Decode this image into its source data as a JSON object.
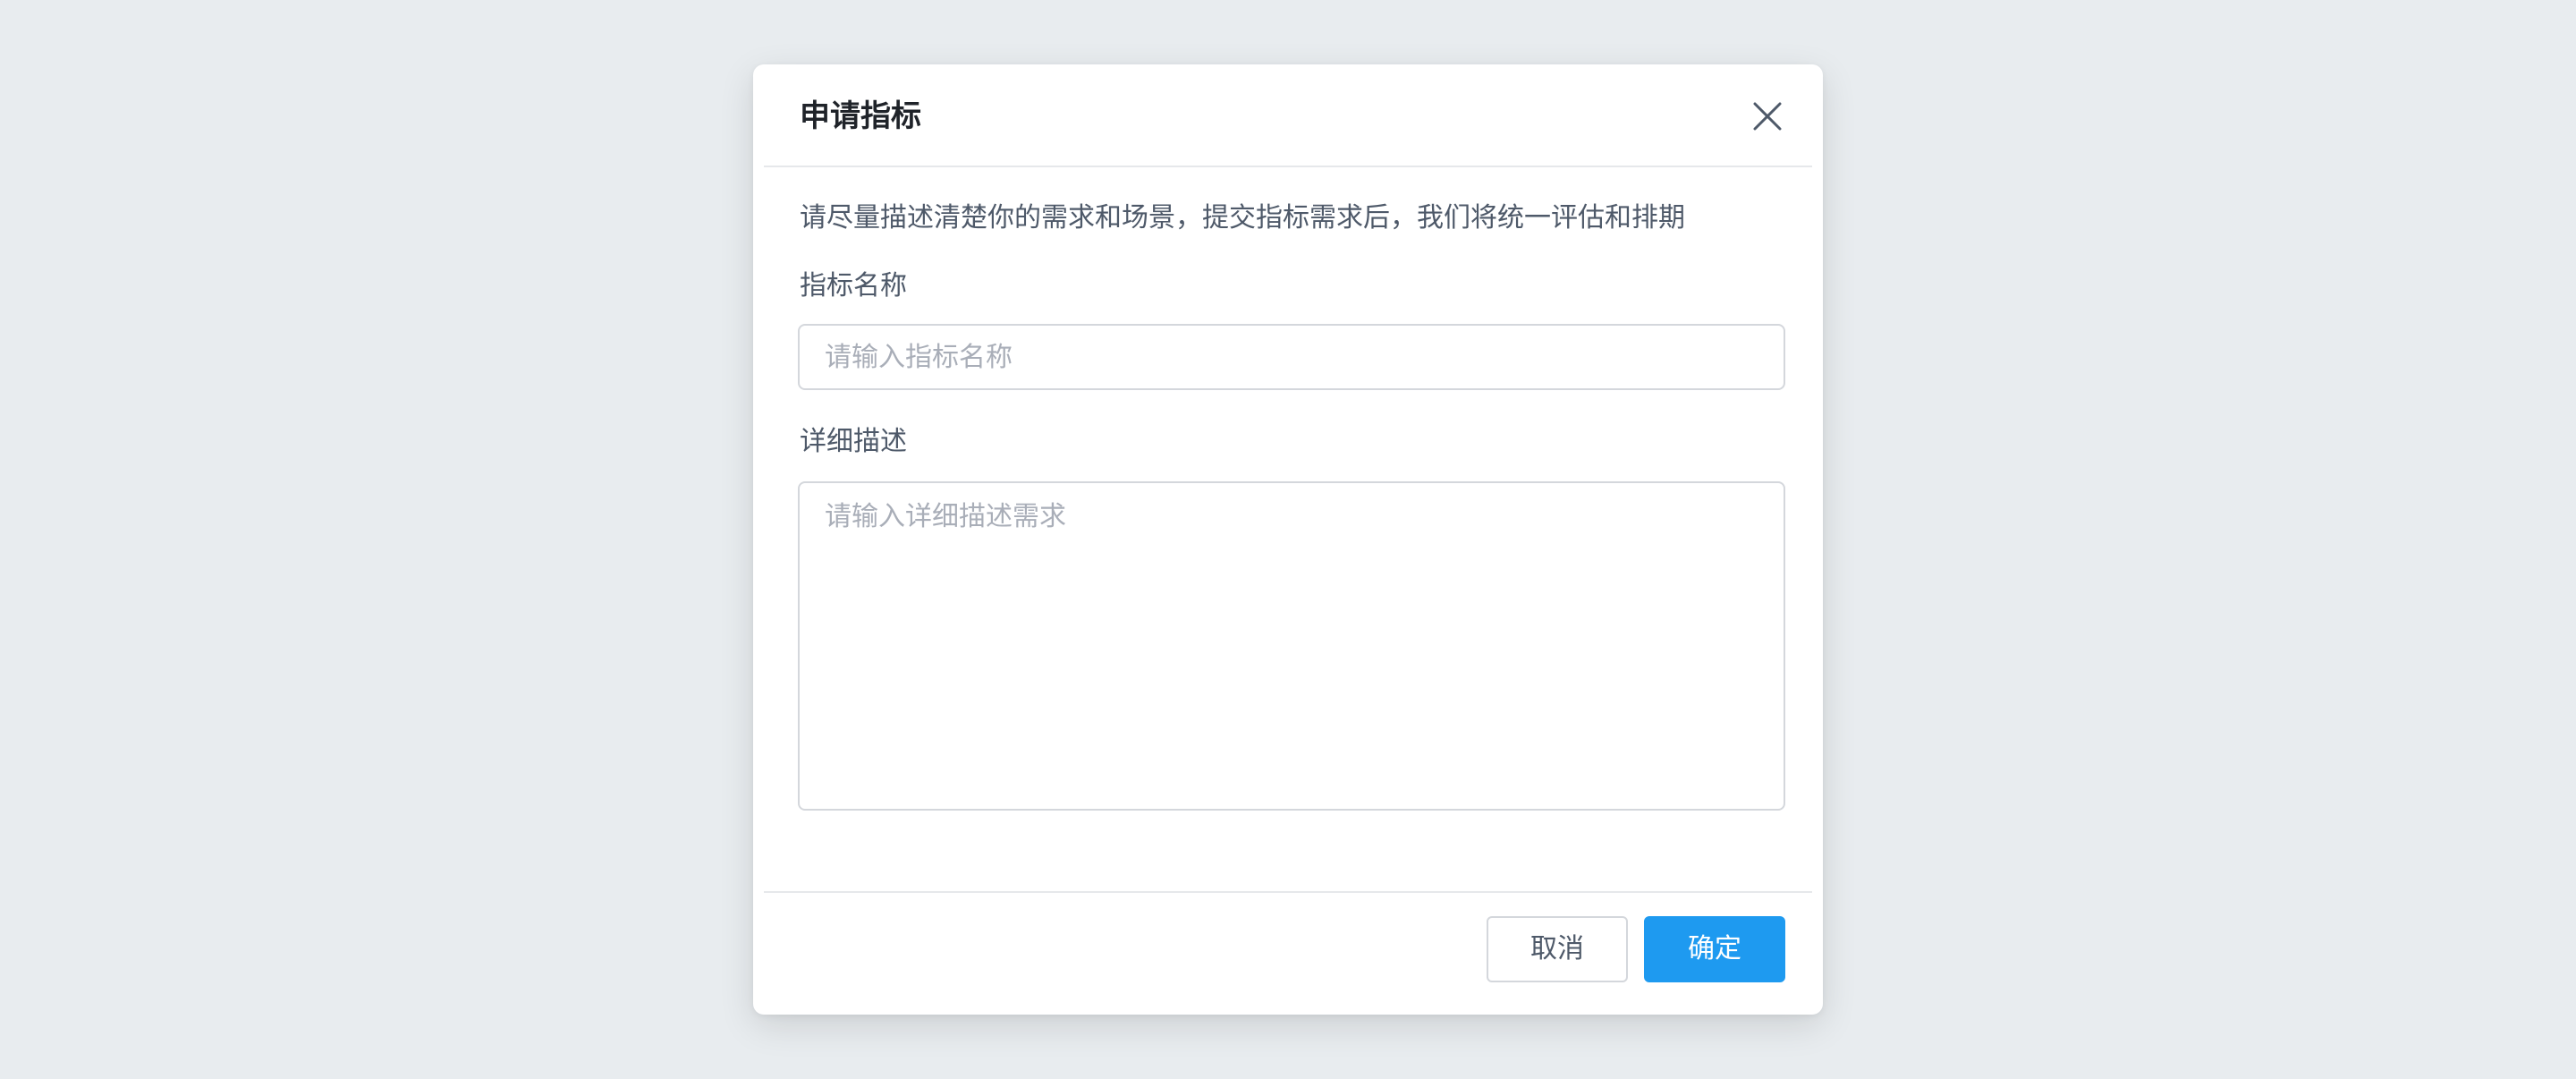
{
  "dialog": {
    "title": "申请指标",
    "close_icon": "close-icon",
    "intro": "请尽量描述清楚你的需求和场景，提交指标需求后，我们将统一评估和排期",
    "fields": {
      "name": {
        "label": "指标名称",
        "value": "",
        "placeholder": "请输入指标名称"
      },
      "description": {
        "label": "详细描述",
        "value": "",
        "placeholder": "请输入详细描述需求"
      }
    },
    "footer": {
      "cancel_label": "取消",
      "ok_label": "确定"
    }
  },
  "colors": {
    "backdrop": "#e8ecef",
    "primary": "#1e9af0",
    "title_text": "#1f2329",
    "body_text": "#4e5969",
    "placeholder": "#a9aeb8",
    "border": "#d4d7dc"
  }
}
